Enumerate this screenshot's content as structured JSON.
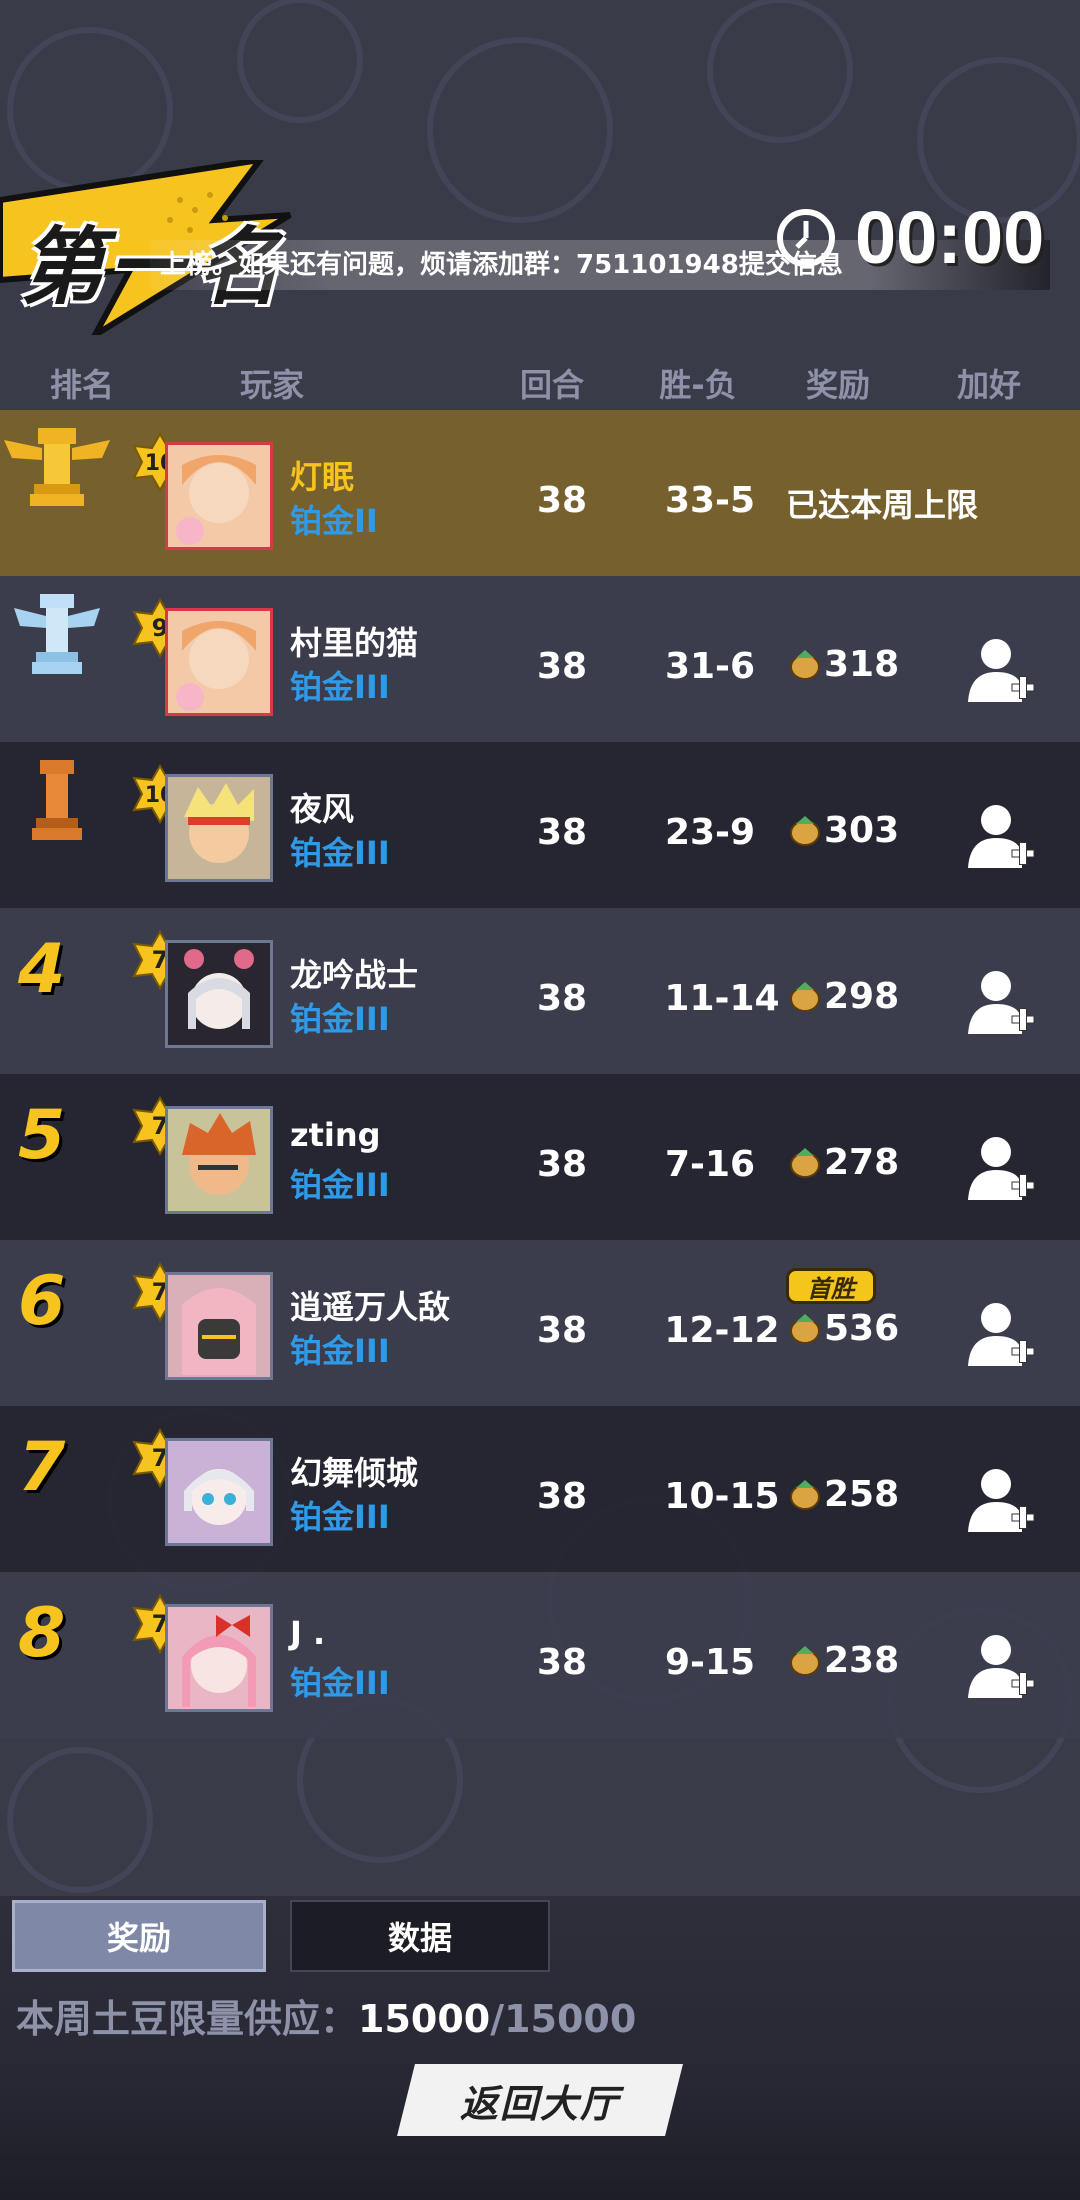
{
  "header": {
    "rank_title": "第一名",
    "marquee": "上榜。如果还有问题，烦请添加群：751101948提交信息",
    "timer": "00:00"
  },
  "columns": [
    "排名",
    "玩家",
    "回合",
    "胜-负",
    "奖励",
    "加好友"
  ],
  "rows": [
    {
      "rank": "1",
      "level": "10",
      "name": "灯眠",
      "tier": "铂金II",
      "rounds": "38",
      "record": "33-5",
      "reward": "",
      "reward_note": "已达本周上限",
      "first_win": ""
    },
    {
      "rank": "2",
      "level": "9",
      "name": "村里的猫",
      "tier": "铂金III",
      "rounds": "38",
      "record": "31-6",
      "reward": "318",
      "reward_note": "",
      "first_win": ""
    },
    {
      "rank": "3",
      "level": "10",
      "name": "夜风",
      "tier": "铂金III",
      "rounds": "38",
      "record": "23-9",
      "reward": "303",
      "reward_note": "",
      "first_win": ""
    },
    {
      "rank": "4",
      "level": "7",
      "name": "龙吟战士",
      "tier": "铂金III",
      "rounds": "38",
      "record": "11-14",
      "reward": "298",
      "reward_note": "",
      "first_win": ""
    },
    {
      "rank": "5",
      "level": "7",
      "name": "zting",
      "tier": "铂金III",
      "rounds": "38",
      "record": "7-16",
      "reward": "278",
      "reward_note": "",
      "first_win": ""
    },
    {
      "rank": "6",
      "level": "7",
      "name": "逍遥万人敌",
      "tier": "铂金III",
      "rounds": "38",
      "record": "12-12",
      "reward": "536",
      "reward_note": "",
      "first_win": "首胜"
    },
    {
      "rank": "7",
      "level": "7",
      "name": "幻舞倾城",
      "tier": "铂金III",
      "rounds": "38",
      "record": "10-15",
      "reward": "258",
      "reward_note": "",
      "first_win": ""
    },
    {
      "rank": "8",
      "level": "7",
      "name": "J .",
      "tier": "铂金III",
      "rounds": "38",
      "record": "9-15",
      "reward": "238",
      "reward_note": "",
      "first_win": ""
    }
  ],
  "footer": {
    "tab_reward": "奖励",
    "tab_data": "数据",
    "supply_label": "本周土豆限量供应：",
    "supply_current": "15000",
    "supply_total": "/15000",
    "back_button": "返回大厅"
  },
  "colors": {
    "gold": "#f6c31f",
    "tier_blue": "#2f9ae8",
    "first_row": "#76602e"
  }
}
